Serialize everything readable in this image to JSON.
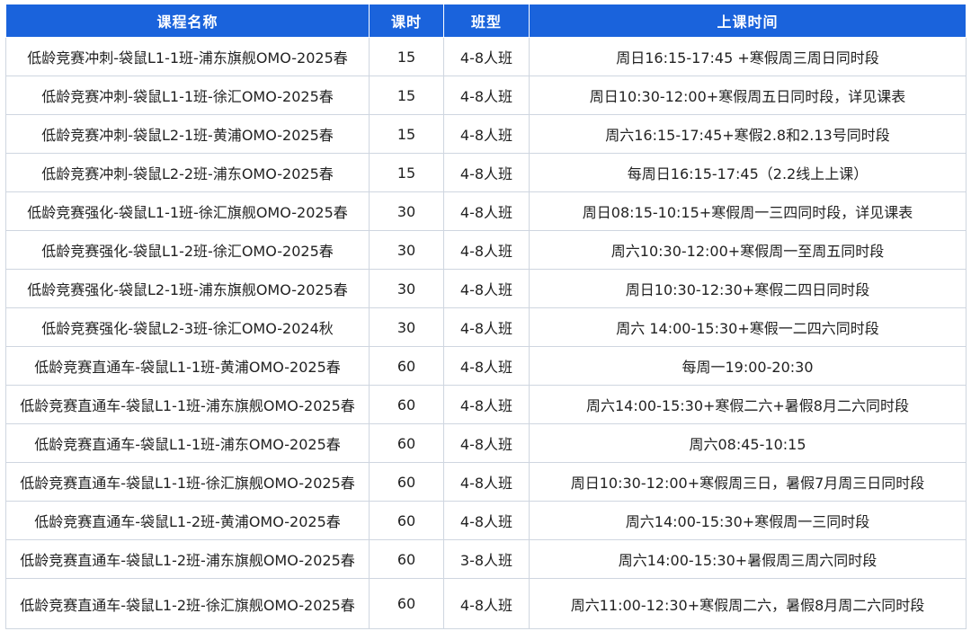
{
  "table": {
    "headers": [
      "课程名称",
      "课时",
      "班型",
      "上课时间"
    ],
    "rows": [
      {
        "name": "低龄竞赛冲刺-袋鼠L1-1班-浦东旗舰OMO-2025春",
        "hours": "15",
        "type": "4-8人班",
        "time": "周日16:15-17:45 +寒假周三周日同时段"
      },
      {
        "name": "低龄竞赛冲刺-袋鼠L1-1班-徐汇OMO-2025春",
        "hours": "15",
        "type": "4-8人班",
        "time": "周日10:30-12:00+寒假周五日同时段，详见课表"
      },
      {
        "name": "低龄竞赛冲刺-袋鼠L2-1班-黄浦OMO-2025春",
        "hours": "15",
        "type": "4-8人班",
        "time": "周六16:15-17:45+寒假2.8和2.13号同时段"
      },
      {
        "name": "低龄竞赛冲刺-袋鼠L2-2班-浦东OMO-2025春",
        "hours": "15",
        "type": "4-8人班",
        "time": "每周日16:15-17:45（2.2线上上课）"
      },
      {
        "name": "低龄竞赛强化-袋鼠L1-1班-徐汇旗舰OMO-2025春",
        "hours": "30",
        "type": "4-8人班",
        "time": "周日08:15-10:15+寒假周一三四同时段，详见课表"
      },
      {
        "name": "低龄竞赛强化-袋鼠L1-2班-徐汇OMO-2025春",
        "hours": "30",
        "type": "4-8人班",
        "time": "周六10:30-12:00+寒假周一至周五同时段"
      },
      {
        "name": "低龄竞赛强化-袋鼠L2-1班-浦东旗舰OMO-2025春",
        "hours": "30",
        "type": "4-8人班",
        "time": "周日10:30-12:30+寒假二四日同时段"
      },
      {
        "name": "低龄竞赛强化-袋鼠L2-3班-徐汇OMO-2024秋",
        "hours": "30",
        "type": "4-8人班",
        "time": "周六 14:00-15:30+寒假一二四六同时段"
      },
      {
        "name": "低龄竞赛直通车-袋鼠L1-1班-黄浦OMO-2025春",
        "hours": "60",
        "type": "4-8人班",
        "time": "每周一19:00-20:30"
      },
      {
        "name": "低龄竞赛直通车-袋鼠L1-1班-浦东旗舰OMO-2025春",
        "hours": "60",
        "type": "4-8人班",
        "time": "周六14:00-15:30+寒假二六+暑假8月二六同时段"
      },
      {
        "name": "低龄竞赛直通车-袋鼠L1-1班-浦东OMO-2025春",
        "hours": "60",
        "type": "4-8人班",
        "time": "周六08:45-10:15"
      },
      {
        "name": "低龄竞赛直通车-袋鼠L1-1班-徐汇旗舰OMO-2025春",
        "hours": "60",
        "type": "4-8人班",
        "time": "周日10:30-12:00+寒假周三日，暑假7月周三日同时段"
      },
      {
        "name": "低龄竞赛直通车-袋鼠L1-2班-黄浦OMO-2025春",
        "hours": "60",
        "type": "4-8人班",
        "time": "周六14:00-15:30+寒假周一三同时段"
      },
      {
        "name": "低龄竞赛直通车-袋鼠L1-2班-浦东旗舰OMO-2025春",
        "hours": "60",
        "type": "3-8人班",
        "time": "周六14:00-15:30+暑假周三周六同时段"
      },
      {
        "name": "低龄竞赛直通车-袋鼠L1-2班-徐汇旗舰OMO-2025春",
        "hours": "60",
        "type": "4-8人班",
        "time": "周六11:00-12:30+寒假周二六，暑假8月周二六同时段"
      }
    ]
  }
}
